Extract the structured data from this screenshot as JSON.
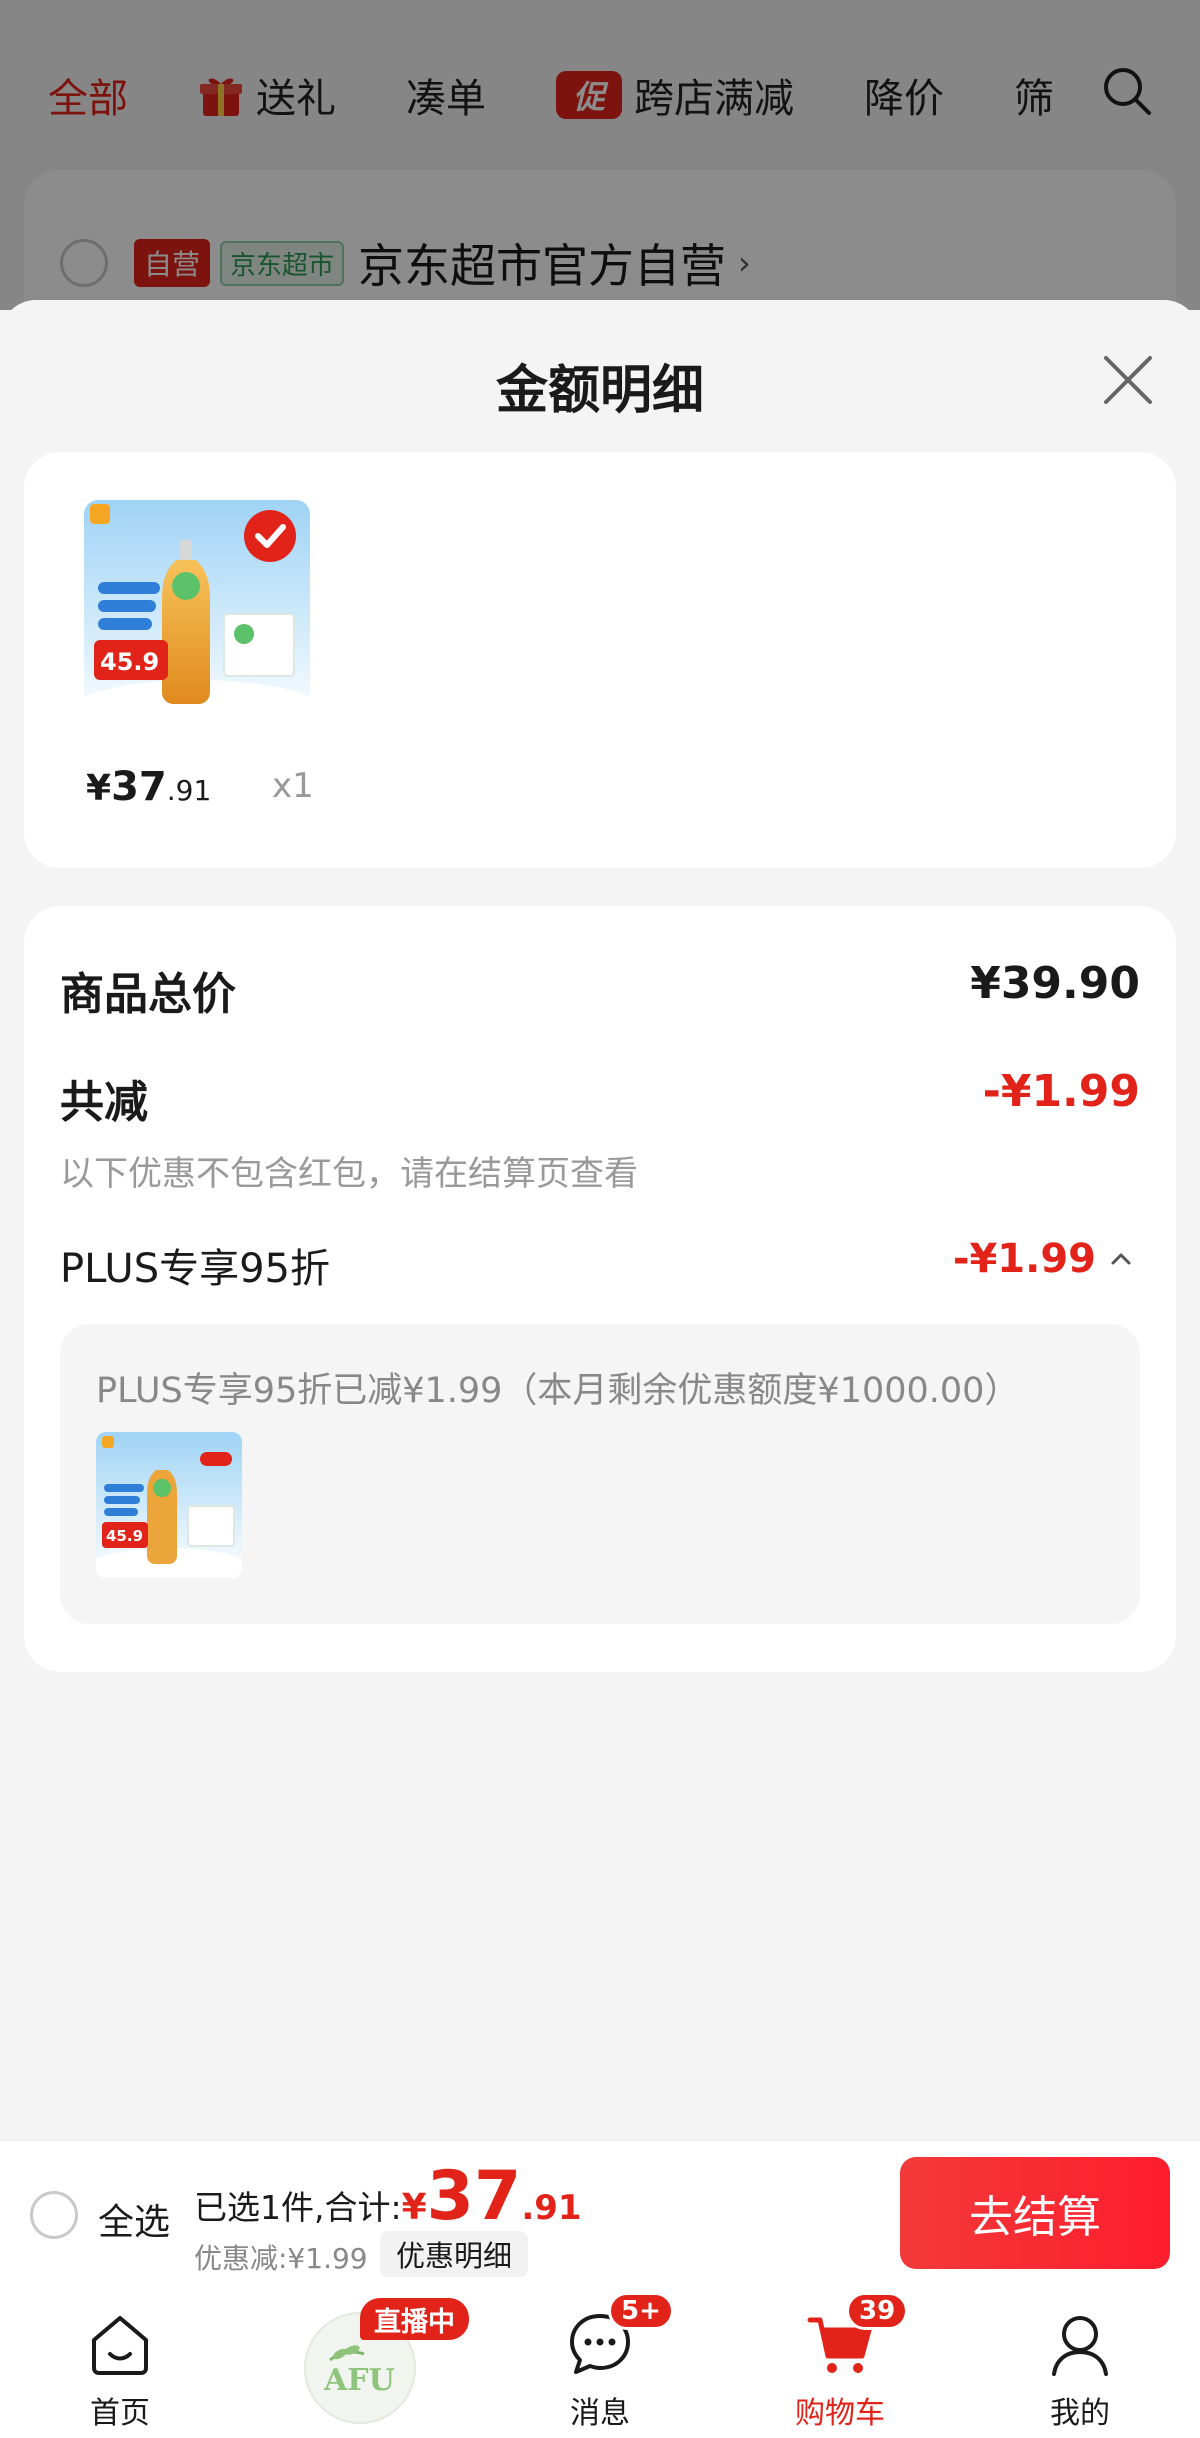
{
  "top_tabs": [
    {
      "label": "全部",
      "active": true
    },
    {
      "label": "送礼",
      "icon": "gift-icon"
    },
    {
      "label": "凑单"
    },
    {
      "label": "跨店满减",
      "badge": "促"
    },
    {
      "label": "降价"
    },
    {
      "label": "筛"
    }
  ],
  "store": {
    "badge_self": "自营",
    "badge_market": "京东超市",
    "name": "京东超市官方自营",
    "chevron": "›"
  },
  "sheet": {
    "title": "金额明细",
    "product": {
      "thumb_price": "45.9",
      "price_currency": "¥",
      "price_int": "37",
      "price_dec": ".91",
      "qty": "x1"
    },
    "total": {
      "label": "商品总价",
      "value": "¥39.90"
    },
    "reduce": {
      "label": "共减",
      "value": "-¥1.99",
      "note": "以下优惠不包含红包，请在结算页查看"
    },
    "plus": {
      "label": "PLUS专享95折",
      "value": "-¥1.99",
      "detail": "PLUS专享95折已减¥1.99（本月剩余优惠额度¥1000.00）",
      "thumb_price": "45.9"
    }
  },
  "checkout": {
    "select_all": "全选",
    "selected_label": "已选1件,合计:",
    "currency": "¥",
    "total_int": "37",
    "total_dec": ".91",
    "discount": "优惠减:¥1.99",
    "detail_button": "优惠明细",
    "button": "去结算"
  },
  "nav": [
    {
      "label": "首页",
      "icon": "home-icon"
    },
    {
      "label": "",
      "icon": "afu-logo",
      "badge": "直播中",
      "logo_text": "AFU"
    },
    {
      "label": "消息",
      "icon": "message-icon",
      "badge": "5+"
    },
    {
      "label": "购物车",
      "icon": "cart-icon",
      "badge": "39",
      "active": true
    },
    {
      "label": "我的",
      "icon": "profile-icon"
    }
  ],
  "colors": {
    "accent": "#e2231a",
    "green": "#2c9b54"
  }
}
